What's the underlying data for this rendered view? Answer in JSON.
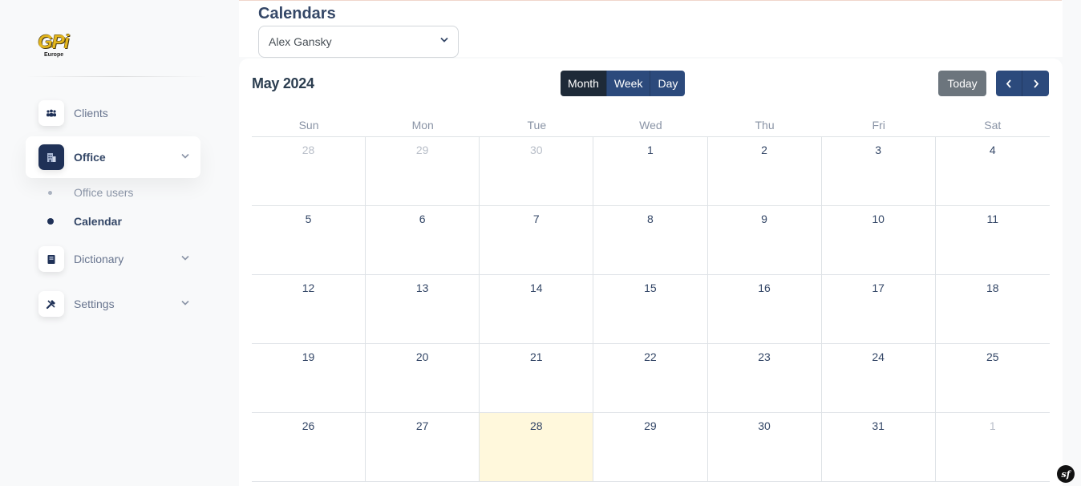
{
  "brand": {
    "logo_text": "GPi",
    "logo_sub": "Europe",
    "logo_color": "#e3b51c"
  },
  "sidebar": {
    "items": [
      {
        "label": "Clients",
        "icon": "group-icon"
      },
      {
        "label": "Office",
        "icon": "building-icon",
        "active": true
      },
      {
        "label": "Dictionary",
        "icon": "book-icon"
      },
      {
        "label": "Settings",
        "icon": "tools-icon"
      }
    ],
    "office_sub": [
      {
        "label": "Office users"
      },
      {
        "label": "Calendar",
        "active": true
      }
    ]
  },
  "header": {
    "title": "Calendars",
    "selected_calendar": "Alex Gansky"
  },
  "calendar": {
    "month_title": "May 2024",
    "views": [
      "Month",
      "Week",
      "Day"
    ],
    "active_view": "Month",
    "today_label": "Today",
    "prev_icon": "chevron-left-icon",
    "next_icon": "chevron-right-icon",
    "weekdays": [
      "Sun",
      "Mon",
      "Tue",
      "Wed",
      "Thu",
      "Fri",
      "Sat"
    ],
    "weeks": [
      [
        "28",
        "29",
        "30",
        "1",
        "2",
        "3",
        "4"
      ],
      [
        "5",
        "6",
        "7",
        "8",
        "9",
        "10",
        "11"
      ],
      [
        "12",
        "13",
        "14",
        "15",
        "16",
        "17",
        "18"
      ],
      [
        "19",
        "20",
        "21",
        "22",
        "23",
        "24",
        "25"
      ],
      [
        "26",
        "27",
        "28",
        "29",
        "30",
        "31",
        "1"
      ]
    ],
    "today_highlight_color": "#fff8dc"
  },
  "footer": {
    "badge": "sf"
  }
}
